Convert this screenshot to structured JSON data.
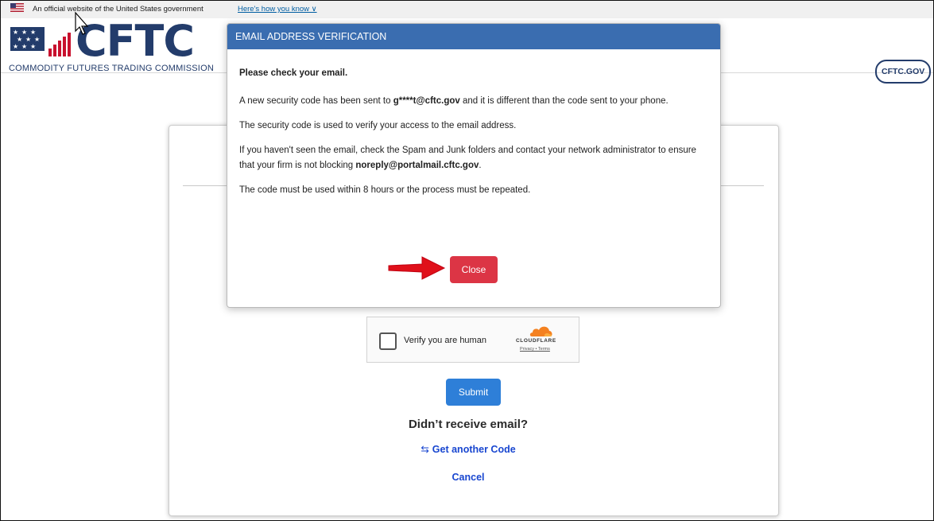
{
  "gov_banner": {
    "official_text": "An official website of the United States government",
    "how_know": "Here's how you know ∨"
  },
  "header": {
    "logo_text": "CFTC",
    "logo_subtitle": "COMMODITY FUTURES TRADING COMMISSION",
    "cftc_gov_link": "CFTC.GOV",
    "brand_color": "#233c6b"
  },
  "modal": {
    "title": "EMAIL ADDRESS VERIFICATION",
    "heading": "Please check your email.",
    "line1_pre": "A new security code has been sent to ",
    "line1_email": "g****t@cftc.gov",
    "line1_post": " and it is different than the code sent to your phone.",
    "line2": "The security code is used to verify your access to the email address.",
    "line3_pre": "If you haven't seen the email, check the Spam and Junk folders and contact your network administrator to ensure that your firm is not blocking ",
    "line3_email": "noreply@portalmail.cftc.gov",
    "line3_post": ".",
    "line4": "The code must be used within 8 hours or the process must be repeated.",
    "close_label": "Close",
    "header_color": "#3a6db0",
    "close_color": "#dc3545"
  },
  "captcha": {
    "label": "Verify you are human",
    "brand": "CLOUDFLARE",
    "links": "Privacy • Terms"
  },
  "form": {
    "submit_label": "Submit",
    "didnt_receive": "Didn’t receive email?",
    "get_another_icon": "⇆",
    "get_another": "Get another Code",
    "cancel": "Cancel"
  },
  "annotation_arrow": "red-arrow-icon"
}
